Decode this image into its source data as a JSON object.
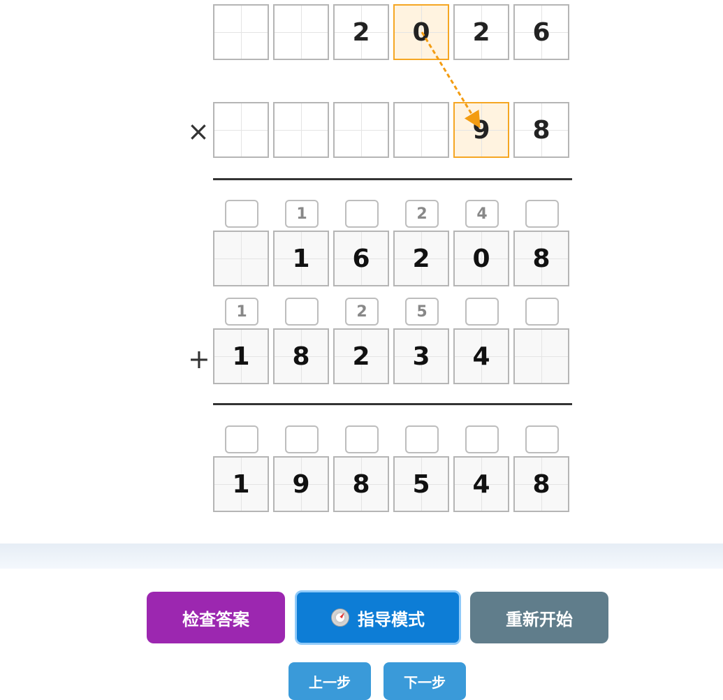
{
  "multiplicand": [
    "",
    "",
    "2",
    "0",
    "2",
    "6"
  ],
  "multiplier": [
    "",
    "",
    "",
    "",
    "9",
    "8"
  ],
  "partial1_carries": [
    "",
    "1",
    "",
    "2",
    "4",
    ""
  ],
  "partial1": [
    "",
    "1",
    "6",
    "2",
    "0",
    "8"
  ],
  "partial2_carries": [
    "1",
    "",
    "2",
    "5",
    "",
    ""
  ],
  "partial2": [
    "1",
    "8",
    "2",
    "3",
    "4",
    ""
  ],
  "sum_carries": [
    "",
    "",
    "",
    "",
    "",
    ""
  ],
  "sum": [
    "1",
    "9",
    "8",
    "5",
    "4",
    "8"
  ],
  "signs": {
    "times": "×",
    "plus": "+"
  },
  "buttons": {
    "check": "检查答案",
    "guide": "指导模式",
    "restart": "重新开始",
    "prev": "上一步",
    "next": "下一步"
  },
  "colors": {
    "highlight_orange": "#f5a623",
    "highlight_blue": "#e3f2fd",
    "check_button": "#9c27b0",
    "guide_button": "#0d7dd6",
    "restart_button": "#607d8b",
    "step_button": "#3a9ad9"
  },
  "icons": {
    "guide": "compass-icon"
  }
}
